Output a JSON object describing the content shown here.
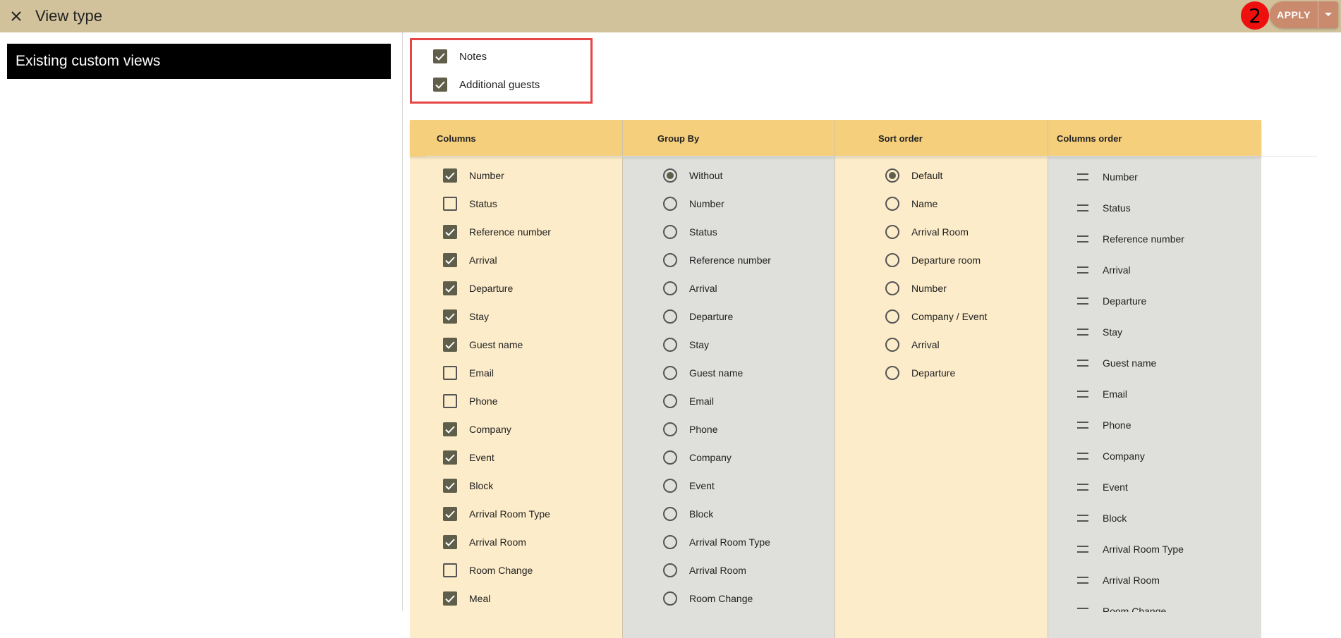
{
  "window": {
    "title": "View type"
  },
  "step_badge": "2",
  "apply_label": "APPLY",
  "left_panel": {
    "header": "Existing custom views"
  },
  "extra_options": [
    {
      "label": "Notes",
      "checked": true
    },
    {
      "label": "Additional guests",
      "checked": true
    }
  ],
  "columns_section": {
    "header": "Columns",
    "items": [
      {
        "label": "Number",
        "checked": true
      },
      {
        "label": "Status",
        "checked": false
      },
      {
        "label": "Reference number",
        "checked": true
      },
      {
        "label": "Arrival",
        "checked": true
      },
      {
        "label": "Departure",
        "checked": true
      },
      {
        "label": "Stay",
        "checked": true
      },
      {
        "label": "Guest name",
        "checked": true
      },
      {
        "label": "Email",
        "checked": false
      },
      {
        "label": "Phone",
        "checked": false
      },
      {
        "label": "Company",
        "checked": true
      },
      {
        "label": "Event",
        "checked": true
      },
      {
        "label": "Block",
        "checked": true
      },
      {
        "label": "Arrival Room Type",
        "checked": true
      },
      {
        "label": "Arrival Room",
        "checked": true
      },
      {
        "label": "Room Change",
        "checked": false
      },
      {
        "label": "Meal",
        "checked": true
      }
    ]
  },
  "group_by_section": {
    "header": "Group By",
    "selected": "Without",
    "items": [
      "Without",
      "Number",
      "Status",
      "Reference number",
      "Arrival",
      "Departure",
      "Stay",
      "Guest name",
      "Email",
      "Phone",
      "Company",
      "Event",
      "Block",
      "Arrival Room Type",
      "Arrival Room",
      "Room Change"
    ]
  },
  "sort_order_section": {
    "header": "Sort order",
    "selected": "Default",
    "items": [
      "Default",
      "Name",
      "Arrival Room",
      "Departure room",
      "Number",
      "Company / Event",
      "Arrival",
      "Departure"
    ]
  },
  "columns_order_section": {
    "header": "Columns order",
    "items": [
      "Number",
      "Status",
      "Reference number",
      "Arrival",
      "Departure",
      "Stay",
      "Guest name",
      "Email",
      "Phone",
      "Company",
      "Event",
      "Block",
      "Arrival Room Type",
      "Arrival Room",
      "Room Change"
    ]
  },
  "colors": {
    "topbar": "#d1c29b",
    "apply_button": "#c98a6e",
    "badge": "#ee0f0f",
    "config_header": "#f6cf7c",
    "columns_bg": "#fcecc9",
    "group_by_bg": "#dfe0dc",
    "sort_order_bg": "#fcecc9",
    "columns_order_bg": "#dfe0dc",
    "checked_box": "#5e5e4a"
  }
}
